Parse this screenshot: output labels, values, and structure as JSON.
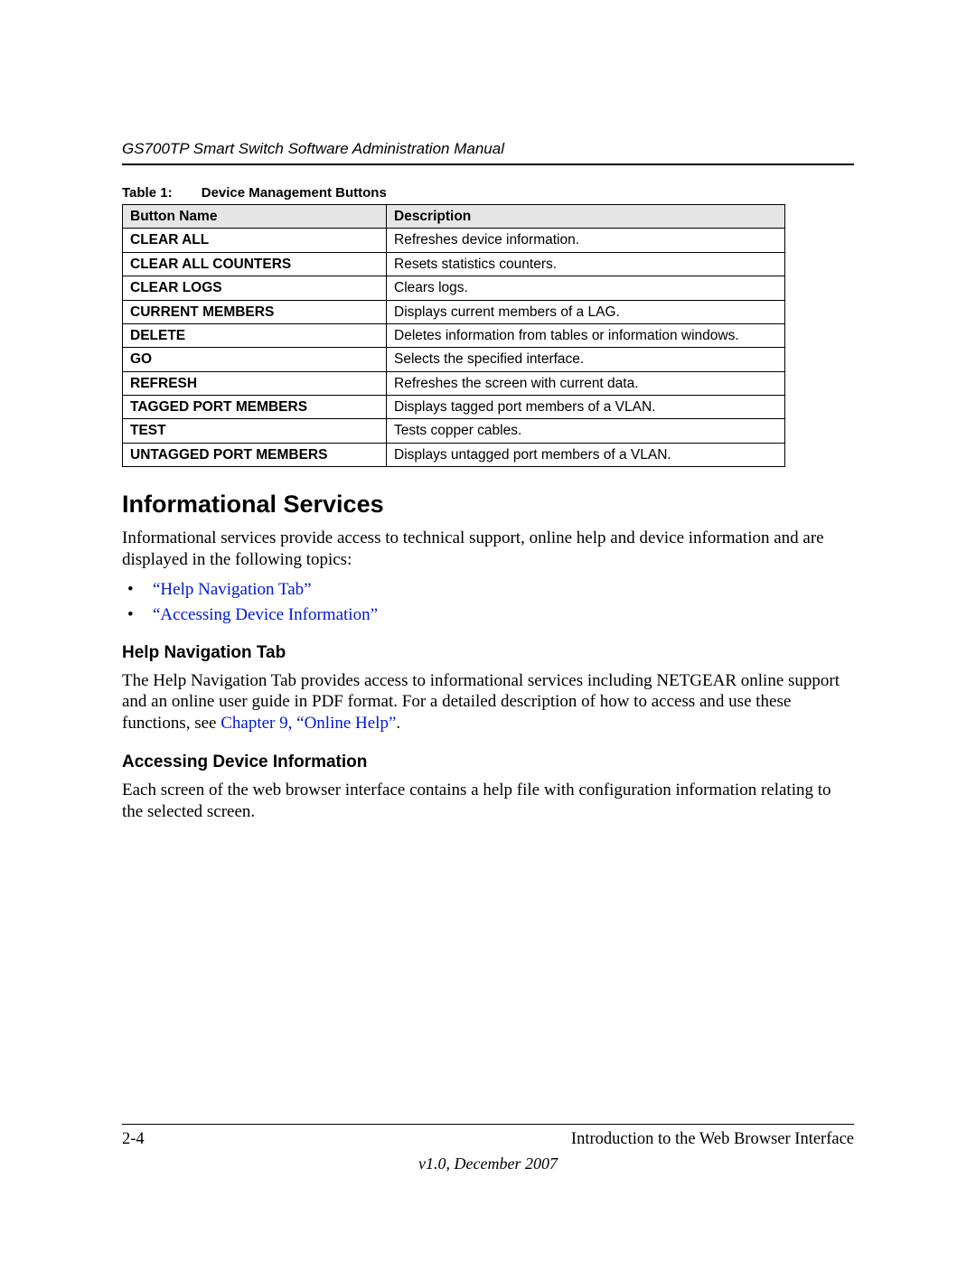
{
  "header": {
    "running_title": "GS700TP Smart Switch Software Administration Manual"
  },
  "table": {
    "caption_label": "Table 1:",
    "caption_title": "Device Management Buttons",
    "col_name": "Button Name",
    "col_desc": "Description",
    "rows": [
      {
        "name": "CLEAR ALL",
        "desc": "Refreshes device information."
      },
      {
        "name": "CLEAR ALL COUNTERS",
        "desc": "Resets statistics counters."
      },
      {
        "name": "CLEAR LOGS",
        "desc": "Clears logs."
      },
      {
        "name": "CURRENT MEMBERS",
        "desc": "Displays current members of a LAG."
      },
      {
        "name": "DELETE",
        "desc": "Deletes information from tables or information windows."
      },
      {
        "name": "GO",
        "desc": "Selects the specified interface."
      },
      {
        "name": "REFRESH",
        "desc": "Refreshes the screen with current data."
      },
      {
        "name": "TAGGED PORT MEMBERS",
        "desc": "Displays tagged port members of a VLAN."
      },
      {
        "name": "TEST",
        "desc": "Tests copper cables."
      },
      {
        "name": "UNTAGGED PORT MEMBERS",
        "desc": "Displays untagged port members of a VLAN."
      }
    ]
  },
  "section": {
    "heading": "Informational Services",
    "intro": "Informational services provide access to technical support, online help and device information and are displayed in the following topics:",
    "links": [
      "“Help Navigation Tab”",
      "“Accessing Device Information”"
    ],
    "sub1": {
      "heading": "Help Navigation Tab",
      "body_pre": "The Help Navigation Tab provides access to informational services including NETGEAR online support and an online user guide in PDF format. For a detailed description of how to access and use these functions, see ",
      "link": "Chapter 9, “Online Help”",
      "body_post": "."
    },
    "sub2": {
      "heading": "Accessing Device Information",
      "body": "Each screen of the web browser interface contains a help file with configuration information relating to the selected screen."
    }
  },
  "footer": {
    "page_num": "2-4",
    "chapter": "Introduction to the Web Browser Interface",
    "version": "v1.0, December 2007"
  }
}
